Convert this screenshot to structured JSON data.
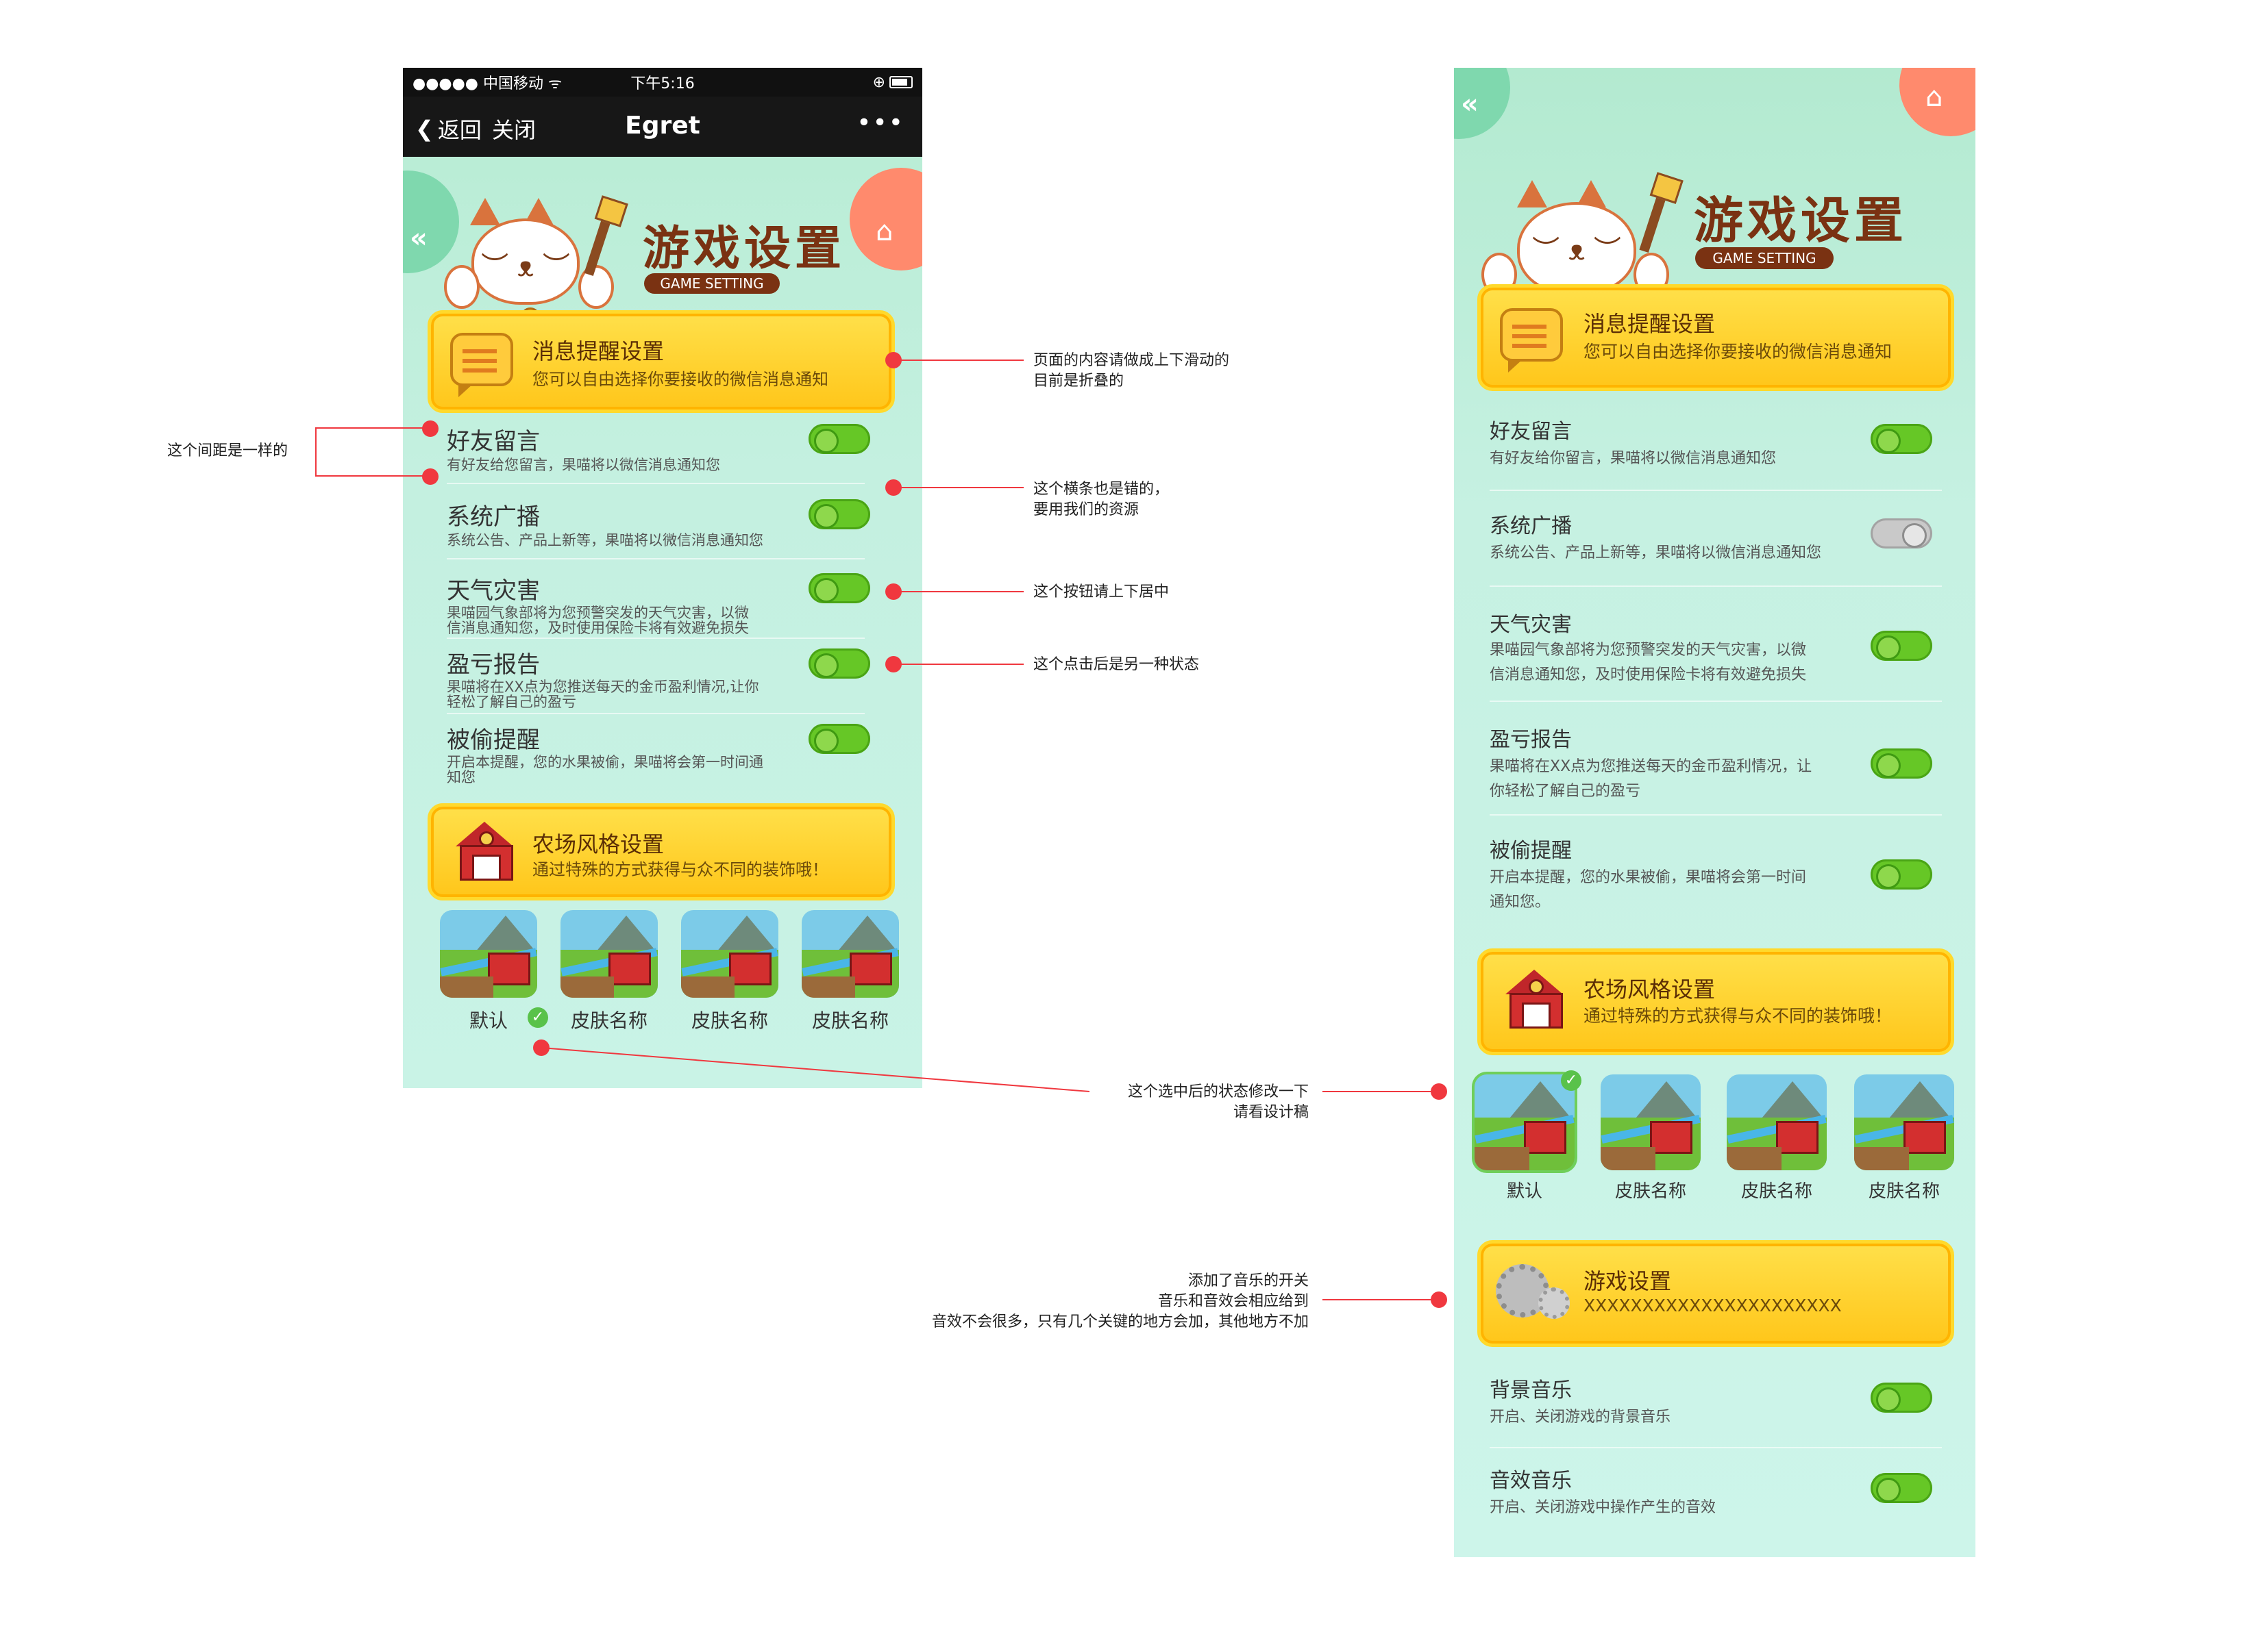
{
  "left_phone": {
    "status_bar": {
      "carrier": "●●●●● 中国移动 ᯤ",
      "time": "下午5:16",
      "status_icon": "⊕"
    },
    "nav_bar": {
      "back_label": "返回",
      "close_label": "关闭",
      "title": "Egret",
      "more_label": "•••"
    },
    "header": {
      "title": "游戏设置",
      "subtitle": "GAME SETTING"
    },
    "message_card": {
      "title": "消息提醒设置",
      "desc": "您可以自由选择你要接收的微信消息通知"
    },
    "settings": [
      {
        "title": "好友留言",
        "desc": [
          "有好友给您留言，果喵将以微信消息通知您"
        ],
        "on": true
      },
      {
        "title": "系统广播",
        "desc": [
          "系统公告、产品上新等，果喵将以微信消息通知您"
        ],
        "on": true
      },
      {
        "title": "天气灾害",
        "desc": [
          "果喵园气象部将为您预警突发的天气灾害，以微",
          "信消息通知您，及时使用保险卡将有效避免损失"
        ],
        "on": true
      },
      {
        "title": "盈亏报告",
        "desc": [
          "果喵将在XX点为您推送每天的金币盈利情况,让你",
          "轻松了解自己的盈亏"
        ],
        "on": true
      },
      {
        "title": "被偷提醒",
        "desc": [
          "开启本提醒，您的水果被偷，果喵将会第一时间通",
          "知您"
        ],
        "on": true
      }
    ],
    "farm_card": {
      "title": "农场风格设置",
      "desc": "通过特殊的方式获得与众不同的装饰哦！"
    },
    "skins": [
      {
        "label": "默认",
        "selected": true
      },
      {
        "label": "皮肤名称",
        "selected": false
      },
      {
        "label": "皮肤名称",
        "selected": false
      },
      {
        "label": "皮肤名称",
        "selected": false
      }
    ]
  },
  "right_phone": {
    "header": {
      "title": "游戏设置",
      "subtitle": "GAME SETTING"
    },
    "message_card": {
      "title": "消息提醒设置",
      "desc": "您可以自由选择你要接收的微信消息通知"
    },
    "settings": [
      {
        "title": "好友留言",
        "desc": [
          "有好友给你留言，果喵将以微信消息通知您"
        ],
        "on": true
      },
      {
        "title": "系统广播",
        "desc": [
          "系统公告、产品上新等，果喵将以微信消息通知您"
        ],
        "on": false
      },
      {
        "title": "天气灾害",
        "desc": [
          "果喵园气象部将为您预警突发的天气灾害，以微",
          "信消息通知您，及时使用保险卡将有效避免损失"
        ],
        "on": true
      },
      {
        "title": "盈亏报告",
        "desc": [
          "果喵将在XX点为您推送每天的金币盈利情况，让",
          "你轻松了解自己的盈亏"
        ],
        "on": true
      },
      {
        "title": "被偷提醒",
        "desc": [
          "开启本提醒，您的水果被偷，果喵将会第一时间",
          "通知您。"
        ],
        "on": true
      }
    ],
    "farm_card": {
      "title": "农场风格设置",
      "desc": "通过特殊的方式获得与众不同的装饰哦！"
    },
    "skins": [
      {
        "label": "默认",
        "selected": true
      },
      {
        "label": "皮肤名称",
        "selected": false
      },
      {
        "label": "皮肤名称",
        "selected": false
      },
      {
        "label": "皮肤名称",
        "selected": false
      }
    ],
    "game_card": {
      "title": "游戏设置",
      "desc": "XXXXXXXXXXXXXXXXXXXXXX"
    },
    "audio_settings": [
      {
        "title": "背景音乐",
        "desc": "开启、关闭游戏的背景音乐",
        "on": true
      },
      {
        "title": "音效音乐",
        "desc": "开启、关闭游戏中操作产生的音效",
        "on": true
      }
    ]
  },
  "annotations": {
    "spacing": "这个间距是一样的",
    "scroll": [
      "页面的内容请做成上下滑动的",
      "目前是折叠的"
    ],
    "divider": [
      "这个横条也是错的，",
      "要用我们的资源"
    ],
    "button_center": "这个按钮请上下居中",
    "toggle_state": "这个点击后是另一种状态",
    "selected_state": [
      "这个选中后的状态修改一下",
      "请看设计稿"
    ],
    "music": [
      "添加了音乐的开关",
      "音乐和音效会相应给到",
      "音效不会很多，只有几个关键的地方会加，其他地方不加"
    ]
  },
  "colors": {
    "accent_red": "#f0383f",
    "toggle_on": "#66c726",
    "toggle_off": "#c9c9c9",
    "card_yellow": "#ffc61a"
  },
  "icons": [
    "back-chevron-icon",
    "home-icon",
    "cat-mascot-icon",
    "message-bubble-icon",
    "barn-icon",
    "gear-icon",
    "check-icon"
  ]
}
